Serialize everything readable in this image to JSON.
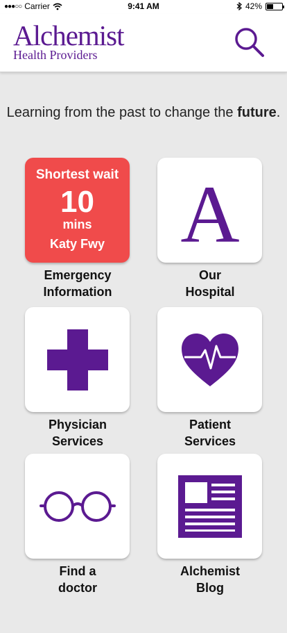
{
  "status_bar": {
    "carrier": "Carrier",
    "time": "9:41 AM",
    "battery": "42%",
    "battery_level": 0.42
  },
  "header": {
    "logo_main": "Alchemist",
    "logo_sub": "Health Providers",
    "search_icon": "search-icon",
    "brand_color": "#5b1a91"
  },
  "tagline": {
    "text_before": "Learning from the past to change the ",
    "bold": "future",
    "text_after": "."
  },
  "tiles": [
    {
      "type": "wait",
      "wait_title": "Shortest wait",
      "wait_number": "10",
      "wait_unit": "mins",
      "wait_location": "Katy Fwy",
      "label_line1": "Emergency",
      "label_line2": "Information",
      "color": "#f04b4b"
    },
    {
      "icon": "letter-a-icon",
      "letter": "A",
      "label_line1": "Our",
      "label_line2": "Hospital"
    },
    {
      "icon": "medical-cross-icon",
      "label_line1": "Physician",
      "label_line2": "Services"
    },
    {
      "icon": "heart-pulse-icon",
      "label_line1": "Patient",
      "label_line2": "Services"
    },
    {
      "icon": "glasses-icon",
      "label_line1": "Find a",
      "label_line2": "doctor"
    },
    {
      "icon": "newspaper-icon",
      "label_line1": "Alchemist",
      "label_line2": "Blog"
    }
  ]
}
